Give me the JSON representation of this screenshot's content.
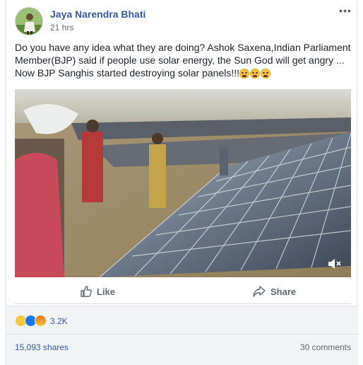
{
  "post": {
    "author": "Jaya Narendra Bhati",
    "time": "21 hrs",
    "more_icon": "ellipsis-icon",
    "text": "Do you have any idea what they are doing? Ashok Saxena,Indian Parliament Member(BJP) said if people use solar energy, the Sun God will get angry ... Now BJP Sanghis started destroying solar panels!!!",
    "trailing_emojis": [
      "tired-face-emoji",
      "tired-face-emoji",
      "tired-face-emoji"
    ]
  },
  "video": {
    "mute_icon": "speaker-muted-icon"
  },
  "actions": {
    "like_label": "Like",
    "share_label": "Share"
  },
  "reactions": {
    "types": [
      "haha",
      "like",
      "angry"
    ],
    "count": "3.2K"
  },
  "stats": {
    "shares": "15,093 shares",
    "comments": "30 comments"
  },
  "colors": {
    "link_blue": "#385898",
    "secondary_gray": "#606770",
    "footer_bg": "#f2f3f5"
  }
}
